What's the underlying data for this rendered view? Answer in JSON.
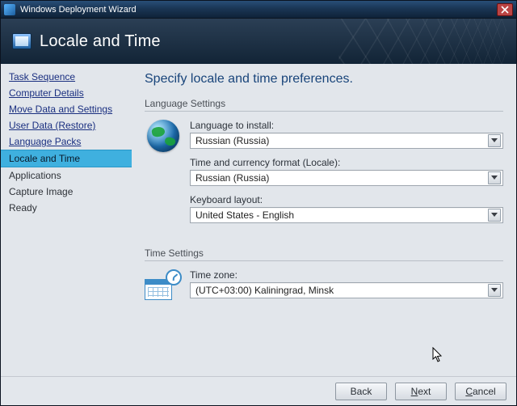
{
  "window": {
    "title": "Windows Deployment Wizard"
  },
  "header": {
    "title": "Locale and Time"
  },
  "sidebar": {
    "items": [
      {
        "label": "Task Sequence",
        "style": "link"
      },
      {
        "label": "Computer Details",
        "style": "link"
      },
      {
        "label": "Move Data and Settings",
        "style": "link"
      },
      {
        "label": "User Data (Restore)",
        "style": "link"
      },
      {
        "label": "Language Packs",
        "style": "link"
      },
      {
        "label": "Locale and Time",
        "style": "active"
      },
      {
        "label": "Applications",
        "style": "plain"
      },
      {
        "label": "Capture Image",
        "style": "plain"
      },
      {
        "label": "Ready",
        "style": "plain"
      }
    ]
  },
  "main": {
    "heading": "Specify locale and time preferences.",
    "language_group": "Language Settings",
    "time_group": "Time Settings",
    "language_to_install": {
      "label": "Language to install:",
      "value": "Russian (Russia)"
    },
    "locale_format": {
      "label": "Time and currency format (Locale):",
      "value": "Russian (Russia)"
    },
    "keyboard": {
      "label": "Keyboard layout:",
      "value": "United States - English"
    },
    "time_zone": {
      "label": "Time zone:",
      "value": "(UTC+03:00) Kaliningrad, Minsk"
    }
  },
  "footer": {
    "back": "Back",
    "next_pre": "",
    "next_u": "N",
    "next_post": "ext",
    "cancel_pre": "",
    "cancel_u": "C",
    "cancel_post": "ancel"
  }
}
